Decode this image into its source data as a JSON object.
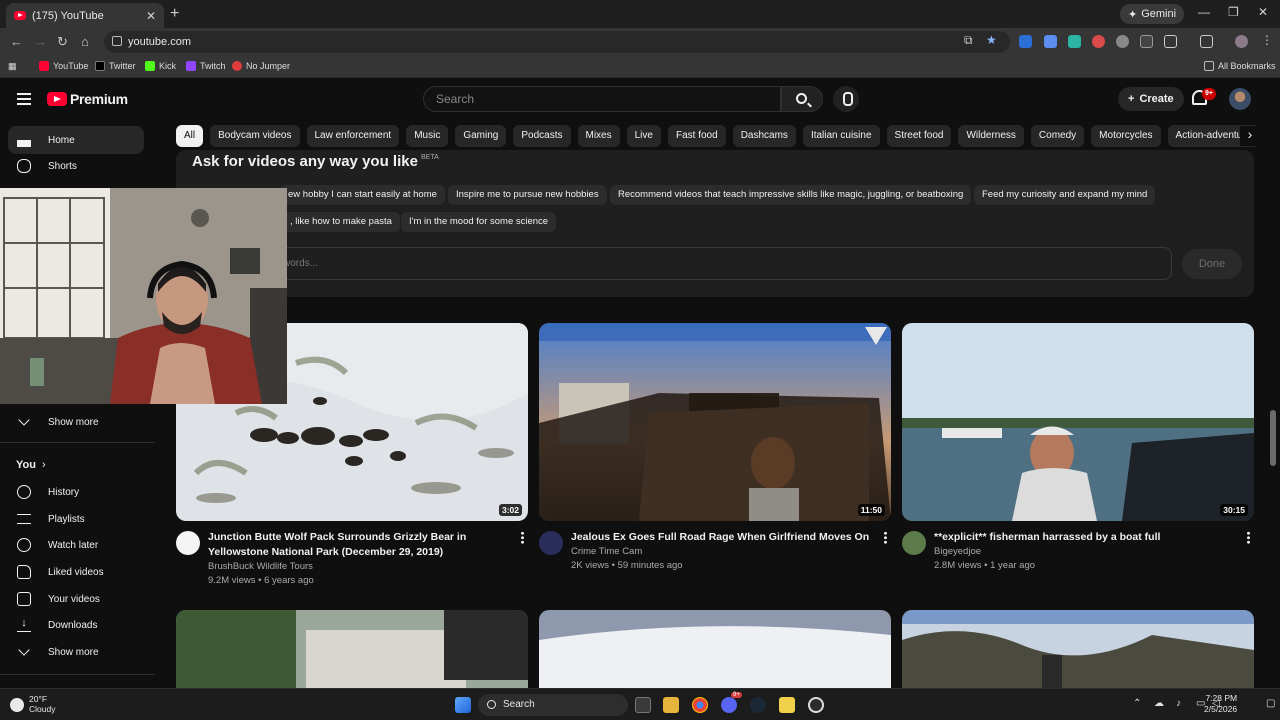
{
  "browser": {
    "tab_title": "(175) YouTube",
    "gemini_label": "Gemini",
    "url": "youtube.com",
    "bookmarks": [
      {
        "label": "YouTube",
        "color": "#ff0033"
      },
      {
        "label": "Twitter",
        "color": "#000000"
      },
      {
        "label": "Kick",
        "color": "#53fc18"
      },
      {
        "label": "Twitch",
        "color": "#9146ff"
      },
      {
        "label": "No Jumper",
        "color": "#e23b3b"
      }
    ],
    "all_bookmarks": "All Bookmarks"
  },
  "masthead": {
    "logo_text": "Premium",
    "search_placeholder": "Search",
    "create_label": "Create",
    "notifications_badge": "9+"
  },
  "sidebar": {
    "items": [
      {
        "label": "Home",
        "icon": "home-icon"
      },
      {
        "label": "Shorts",
        "icon": "shorts-icon"
      },
      {
        "label": "Show more",
        "icon": "chevron-down-icon"
      },
      {
        "label": "You",
        "icon": "chevron-right-icon"
      },
      {
        "label": "History",
        "icon": "history-icon"
      },
      {
        "label": "Playlists",
        "icon": "playlists-icon"
      },
      {
        "label": "Watch later",
        "icon": "clock-icon"
      },
      {
        "label": "Liked videos",
        "icon": "thumbs-up-icon"
      },
      {
        "label": "Your videos",
        "icon": "play-icon"
      },
      {
        "label": "Downloads",
        "icon": "download-icon"
      },
      {
        "label": "Show more",
        "icon": "chevron-down-icon"
      }
    ]
  },
  "chips": [
    "All",
    "Bodycam videos",
    "Law enforcement",
    "Music",
    "Gaming",
    "Podcasts",
    "Mixes",
    "Live",
    "Fast food",
    "Dashcams",
    "Italian cuisine",
    "Street food",
    "Wilderness",
    "Comedy",
    "Motorcycles",
    "Action-adventure ga"
  ],
  "ask": {
    "title": "Ask for videos any way you like",
    "beta": "BETA",
    "suggestions": [
      "ew hobby I can start easily at home",
      "Inspire me to pursue new hobbies",
      "Recommend videos that teach impressive skills like magic, juggling, or beatboxing",
      "Feed my curiosity and expand my mind",
      ", like how to make pasta",
      "I'm in the mood for some science"
    ],
    "input_placeholder": "words...",
    "done_label": "Done"
  },
  "videos": [
    {
      "title": "Junction Butte Wolf Pack Surrounds Grizzly Bear in Yellowstone National Park (December 29, 2019)",
      "channel": "BrushBuck Wildlife Tours",
      "stats": "9.2M views • 6 years ago",
      "duration": "3:02"
    },
    {
      "title": "Jealous Ex Goes Full Road Rage When Girlfriend Moves On",
      "channel": "Crime Time Cam",
      "stats": "2K views • 59 minutes ago",
      "duration": "11:50"
    },
    {
      "title": "**explicit**  fisherman harrassed by a boat full",
      "channel": "Bigeyedjoe",
      "stats": "2.8M views • 1 year ago",
      "duration": "30:15"
    }
  ],
  "taskbar": {
    "weather_temp": "20°F",
    "weather_desc": "Cloudy",
    "search_label": "Search",
    "discord_badge": "9+",
    "time": "7:28 PM",
    "date": "2/5/2026"
  },
  "colors": {
    "background": "#0f0f0f",
    "accent_red": "#ff0033",
    "chip_bg": "#272727"
  }
}
